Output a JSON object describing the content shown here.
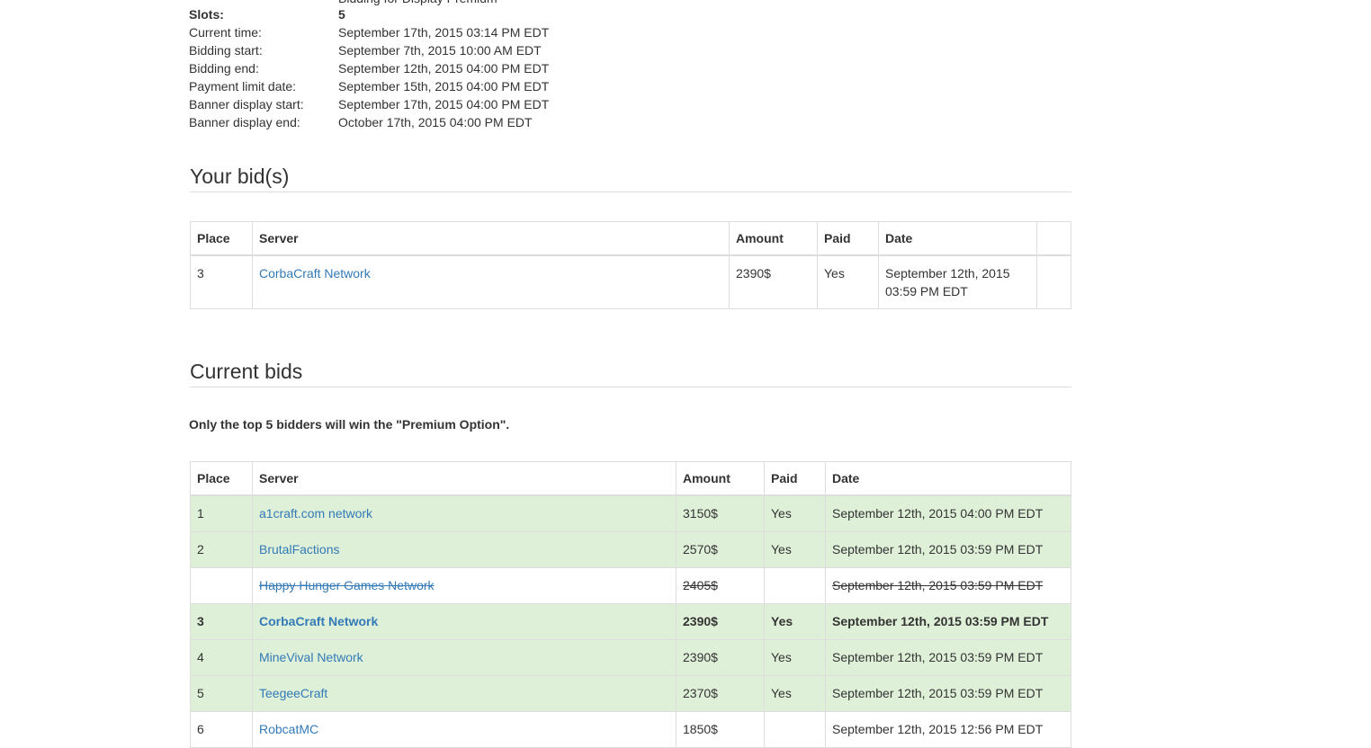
{
  "top_partial": "Bidding for Display Premium",
  "info": [
    {
      "label": "Slots:",
      "value": "5",
      "bold": true
    },
    {
      "label": "Current time:",
      "value": "September 17th, 2015 03:14 PM EDT"
    },
    {
      "label": "Bidding start:",
      "value": "September 7th, 2015 10:00 AM EDT"
    },
    {
      "label": "Bidding end:",
      "value": "September 12th, 2015 04:00 PM EDT"
    },
    {
      "label": "Payment limit date:",
      "value": "September 15th, 2015 04:00 PM EDT"
    },
    {
      "label": "Banner display start:",
      "value": "September 17th, 2015 04:00 PM EDT"
    },
    {
      "label": "Banner display end:",
      "value": "October 17th, 2015 04:00 PM EDT"
    }
  ],
  "your_bids": {
    "title": "Your bid(s)",
    "headers": [
      "Place",
      "Server",
      "Amount",
      "Paid",
      "Date",
      ""
    ],
    "rows": [
      {
        "place": "3",
        "server": "CorbaCraft Network",
        "amount": "2390$",
        "paid": "Yes",
        "date_line1": "September 12th, 2015",
        "date_line2": "03:59 PM EDT"
      }
    ]
  },
  "current_bids": {
    "title": "Current bids",
    "note": "Only the top 5 bidders will win the \"Premium Option\".",
    "headers": [
      "Place",
      "Server",
      "Amount",
      "Paid",
      "Date"
    ],
    "rows": [
      {
        "place": "1",
        "server": "a1craft.com network",
        "amount": "3150$",
        "paid": "Yes",
        "date": "September 12th, 2015 04:00 PM EDT",
        "status": "win"
      },
      {
        "place": "2",
        "server": "BrutalFactions",
        "amount": "2570$",
        "paid": "Yes",
        "date": "September 12th, 2015 03:59 PM EDT",
        "status": "win"
      },
      {
        "place": "",
        "server": "Happy Hunger Games Network",
        "amount": "2405$",
        "paid": "",
        "date": "September 12th, 2015 03:59 PM EDT",
        "status": "struck"
      },
      {
        "place": "3",
        "server": "CorbaCraft Network",
        "amount": "2390$",
        "paid": "Yes",
        "date": "September 12th, 2015 03:59 PM EDT",
        "status": "mine"
      },
      {
        "place": "4",
        "server": "MineVival Network",
        "amount": "2390$",
        "paid": "Yes",
        "date": "September 12th, 2015 03:59 PM EDT",
        "status": "win"
      },
      {
        "place": "5",
        "server": "TeegeeCraft",
        "amount": "2370$",
        "paid": "Yes",
        "date": "September 12th, 2015 03:59 PM EDT",
        "status": "win"
      },
      {
        "place": "6",
        "server": "RobcatMC",
        "amount": "1850$",
        "paid": "",
        "date": "September 12th, 2015 12:56 PM EDT",
        "status": "normal"
      }
    ]
  },
  "colors": {
    "win_row": "#dff0d8",
    "link": "#337ab7",
    "border": "#dddddd"
  }
}
